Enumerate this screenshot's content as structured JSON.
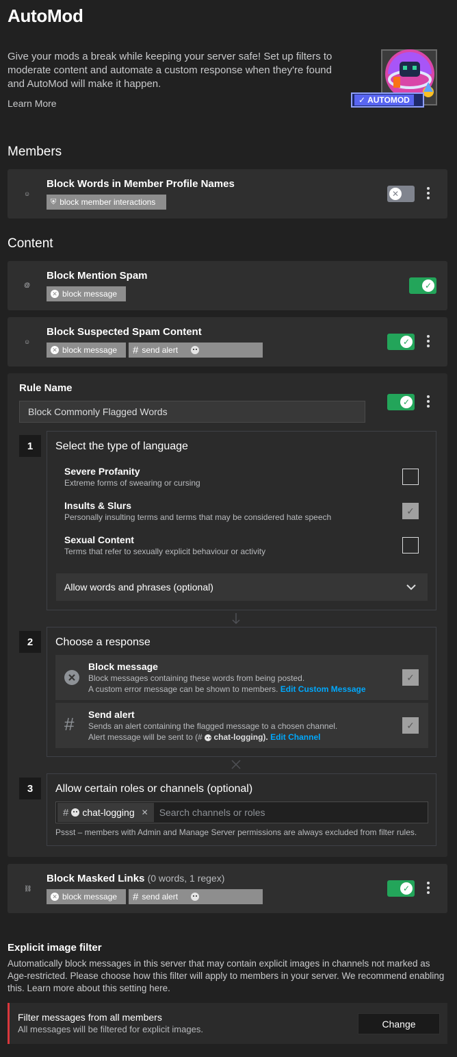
{
  "header": {
    "title": "AutoMod",
    "intro": "Give your mods a break while keeping your server safe! Set up filters to moderate content and automate a custom response when they're found and AutoMod will make it happen.",
    "learn_more": "Learn More",
    "badge_label": "AUTOMOD"
  },
  "sections": {
    "members": "Members",
    "content": "Content"
  },
  "rules": {
    "profile_names": {
      "title": "Block Words in Member Profile Names",
      "chip": "block member interactions",
      "enabled": false
    },
    "mention_spam": {
      "title": "Block Mention Spam",
      "chip": "block message",
      "enabled": true
    },
    "suspected_spam": {
      "title": "Block Suspected Spam Content",
      "chip_block": "block message",
      "chip_alert": "send alert",
      "enabled": true
    },
    "flagged_words": {
      "rule_name_label": "Rule Name",
      "rule_name_value": "Block Commonly Flagged Words",
      "enabled": true,
      "step1": {
        "num": "1",
        "title": "Select the type of language",
        "options": [
          {
            "title": "Severe Profanity",
            "desc": "Extreme forms of swearing or cursing",
            "checked": false
          },
          {
            "title": "Insults & Slurs",
            "desc": "Personally insulting terms and terms that may be considered hate speech",
            "checked": true
          },
          {
            "title": "Sexual Content",
            "desc": "Terms that refer to sexually explicit behaviour or activity",
            "checked": false
          }
        ],
        "allow_words": "Allow words and phrases (optional)"
      },
      "step2": {
        "num": "2",
        "title": "Choose a response",
        "block": {
          "title": "Block message",
          "desc": "Block messages containing these words from being posted.",
          "desc2": "A custom error message can be shown to members.",
          "link": "Edit Custom Message",
          "checked": true
        },
        "alert": {
          "title": "Send alert",
          "desc": "Sends an alert containing the flagged message to a chosen channel.",
          "desc2_prefix": "Alert message will be sent to (#",
          "desc2_channel": "chat-logging).",
          "link": "Edit Channel",
          "checked": true
        }
      },
      "step3": {
        "num": "3",
        "title": "Allow certain roles or channels (optional)",
        "tag": "chat-logging",
        "search_placeholder": "Search channels or roles",
        "note": "Pssst – members with Admin and Manage Server permissions are always excluded from filter rules."
      }
    },
    "masked_links": {
      "title": "Block Masked Links",
      "subtitle": "(0 words, 1 regex)",
      "chip_block": "block message",
      "chip_alert": "send alert",
      "enabled": true
    }
  },
  "explicit": {
    "title": "Explicit image filter",
    "desc": "Automatically block messages in this server that may contain explicit images in channels not marked as Age-restricted. Please choose how this filter will apply to members in your server. We recommend enabling this. Learn more about this setting here.",
    "setting_title": "Filter messages from all members",
    "setting_desc": "All messages will be filtered for explicit images.",
    "change_button": "Change"
  },
  "colors": {
    "toggle_on": "#23a55a",
    "toggle_off": "#80848e",
    "link": "#00a8fc",
    "alert_bar": "#da373c",
    "badge": "#5865f2"
  }
}
